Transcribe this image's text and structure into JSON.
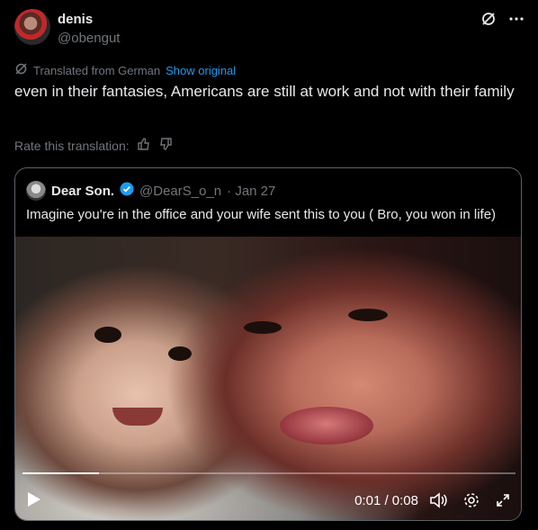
{
  "tweet": {
    "author_name": "denis",
    "author_handle": "@obengut",
    "translated_label": "Translated from German",
    "show_original": "Show original",
    "text": "even in their fantasies, Americans are still at work and not with their family",
    "rate_label": "Rate this translation:"
  },
  "quote": {
    "name": "Dear Son.",
    "handle": "@DearS_o_n",
    "date": "· Jan 27",
    "text": "Imagine you're in the office and your wife sent this to you ( Bro, you won in life)",
    "verified_color": "#1d9bf0"
  },
  "video": {
    "time": "0:01 / 0:08",
    "progress": 0.155
  },
  "icons": [
    "grok-icon",
    "more-icon",
    "translate-icon",
    "thumbs-up-icon",
    "thumbs-down-icon",
    "verified-icon",
    "play-icon",
    "volume-icon",
    "settings-icon",
    "fullscreen-icon"
  ]
}
